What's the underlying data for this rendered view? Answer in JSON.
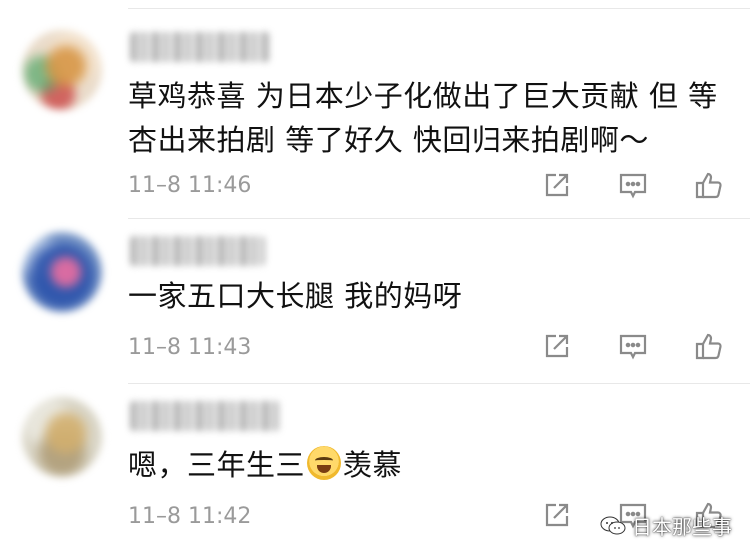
{
  "comments": [
    {
      "lines": [
        "草鸡恭喜 为日本少子化做出了巨大贡献 但 等",
        "杏出来拍剧 等了好久 快回归来拍剧啊～"
      ],
      "time": "11–8 11:46"
    },
    {
      "lines": [
        "一家五口大长腿 我的妈呀"
      ],
      "time": "11–8 11:43"
    },
    {
      "text_before": "嗯，三年生三",
      "emoji": "laughing-crying-emoji",
      "text_after": "羡慕",
      "time": "11–8 11:42"
    }
  ],
  "icons": {
    "share": "share-icon",
    "reply": "comment-icon",
    "like": "thumbs-up-icon"
  },
  "watermark": {
    "text": "日本那些事",
    "icon": "wechat-icon"
  },
  "colors": {
    "text": "#111111",
    "timestamp": "#9a9a9a",
    "icon": "#8a8a8a",
    "divider": "#e8e8e8"
  }
}
